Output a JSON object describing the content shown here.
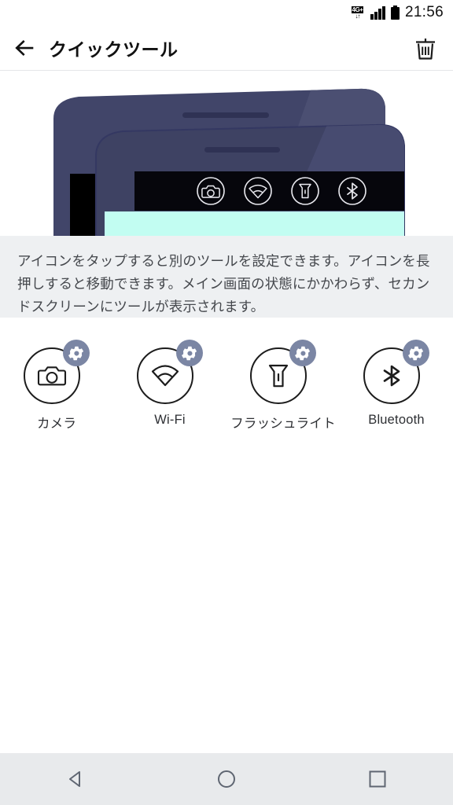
{
  "status_bar": {
    "network_label": "4G+",
    "network_arrows": "↓↑",
    "signal_icon": "signal-bars-icon",
    "battery_icon": "battery-full-icon",
    "time": "21:56"
  },
  "header": {
    "back_icon": "back-arrow-icon",
    "title": "クイックツール",
    "delete_icon": "trash-icon"
  },
  "illustration": {
    "name": "second-screen-phone-illustration",
    "strip_icons": [
      "camera-icon",
      "wifi-icon",
      "flashlight-icon",
      "bluetooth-icon"
    ],
    "colors": {
      "phone_back": "#414569",
      "phone_front": "#3e4263",
      "highlight": "#4b4f72",
      "bezel": "#000000",
      "screen": "#c2fdf2",
      "outline": "#2f3254"
    }
  },
  "description": {
    "text": "アイコンをタップすると別のツールを設定できます。アイコンを長押しすると移動できます。メイン画面の状態にかかわらず、セカンドスクリーンにツールが表示されます。",
    "background": "#eef0f2"
  },
  "tools": [
    {
      "label": "カメラ",
      "icon": "camera-icon",
      "badge_icon": "gear-icon"
    },
    {
      "label": "Wi-Fi",
      "icon": "wifi-icon",
      "badge_icon": "gear-icon"
    },
    {
      "label": "フラッシュライト",
      "icon": "flashlight-icon",
      "badge_icon": "gear-icon"
    },
    {
      "label": "Bluetooth",
      "icon": "bluetooth-icon",
      "badge_icon": "gear-icon"
    }
  ],
  "nav_bar": {
    "back_icon": "nav-back-triangle-icon",
    "home_icon": "nav-home-circle-icon",
    "recents_icon": "nav-recents-square-icon",
    "background": "#e8eaec",
    "icon_color": "#5f6672"
  }
}
